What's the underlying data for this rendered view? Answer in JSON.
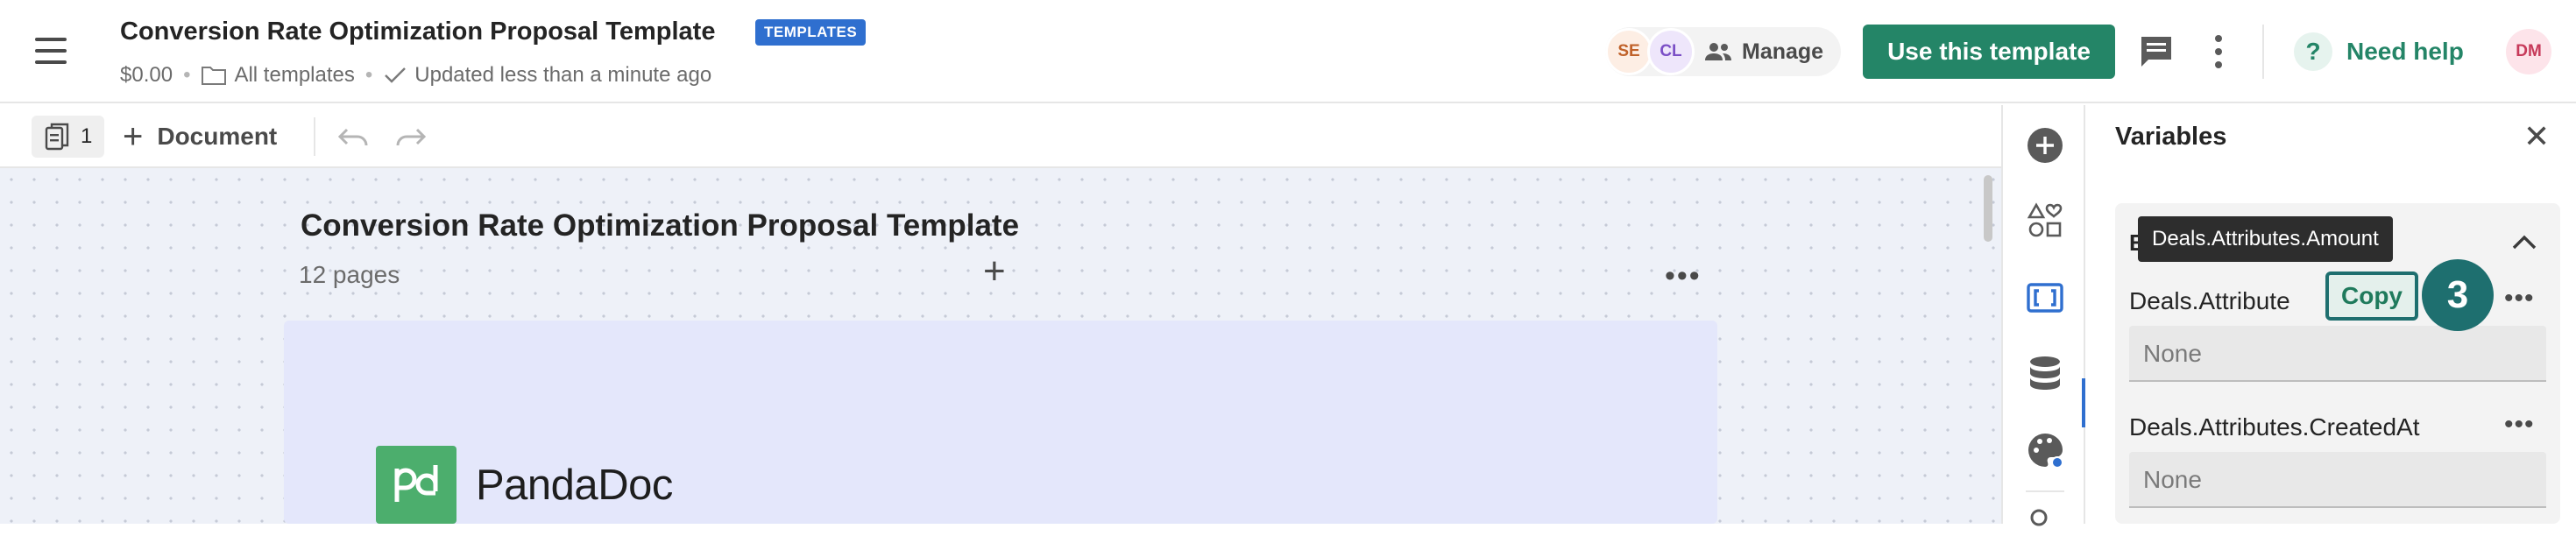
{
  "header": {
    "document_title": "Conversion Rate Optimization Proposal Template",
    "badge": "TEMPLATES",
    "price": "$0.00",
    "folder": "All templates",
    "status": "Updated less than a minute ago",
    "avatars": [
      "SE",
      "CL"
    ],
    "manage_label": "Manage",
    "use_template_label": "Use this template",
    "help_label": "Need help",
    "user_initials": "DM"
  },
  "toolbar": {
    "page_count": "1",
    "add_document_label": "Document"
  },
  "canvas": {
    "title": "Conversion Rate Optimization Proposal Template",
    "pages_label": "12 pages",
    "logo_text": "PandaDoc"
  },
  "variables_panel": {
    "title": "Variables",
    "group_label": "E",
    "tooltip": "Deals.Attributes.Amount",
    "copy_label": "Copy",
    "step_number": "3",
    "variables": [
      {
        "name": "Deals.Attribute",
        "value_placeholder": "None"
      },
      {
        "name": "Deals.Attributes.CreatedAt",
        "value_placeholder": "None"
      }
    ]
  },
  "colors": {
    "brand_green": "#248567",
    "badge_blue": "#2f6fcf",
    "highlight_teal": "#1e6f6f",
    "canvas_bg": "#eef1f8",
    "page_bg": "#e4e7fb"
  }
}
